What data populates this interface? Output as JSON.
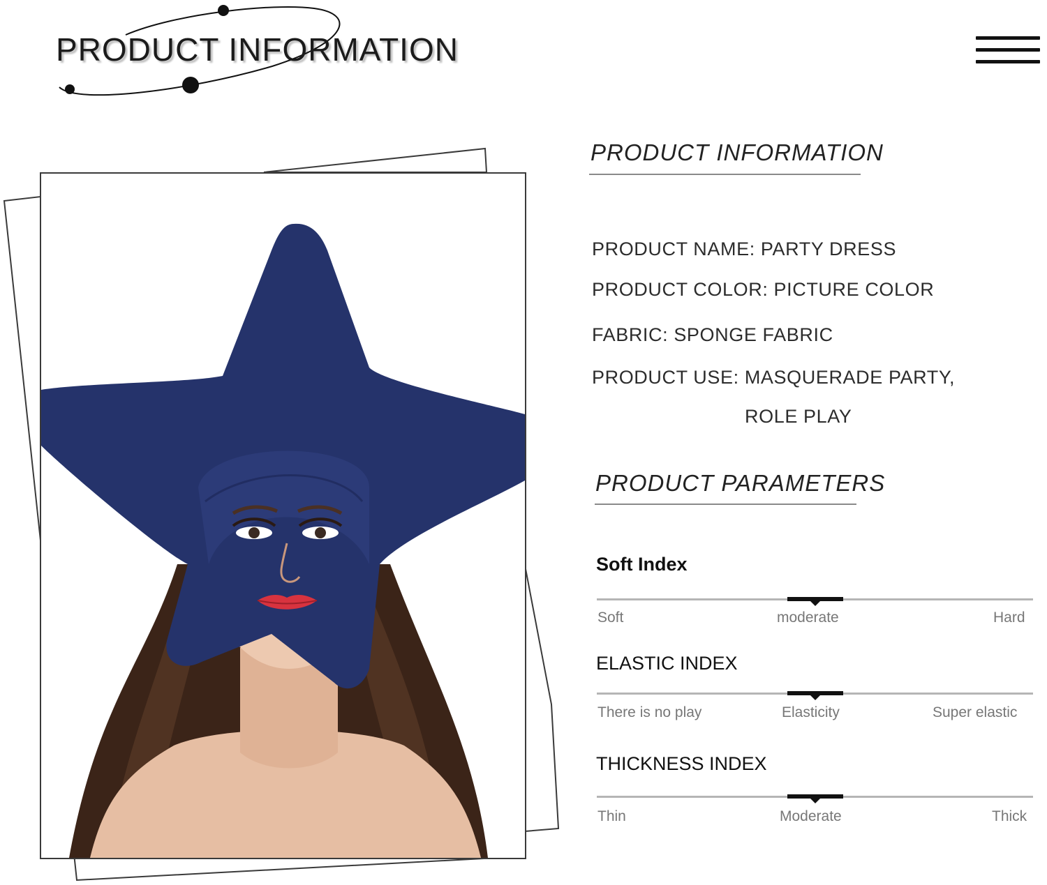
{
  "header": {
    "title": "PRODUCT INFORMATION"
  },
  "info_section": {
    "title": "PRODUCT INFORMATION",
    "lines": [
      "PRODUCT NAME: PARTY DRESS",
      "PRODUCT COLOR: PICTURE COLOR",
      "FABRIC: SPONGE FABRIC",
      "PRODUCT USE: MASQUERADE PARTY,",
      "ROLE PLAY"
    ]
  },
  "params_section": {
    "title": "PRODUCT PARAMETERS",
    "scales": [
      {
        "label": "Soft Index",
        "left": "Soft",
        "middle": "moderate",
        "right": "Hard",
        "level": 0.5
      },
      {
        "label": "ELASTIC INDEX",
        "left": "There is no play",
        "middle": "Elasticity",
        "right": "Super elastic",
        "level": 0.5
      },
      {
        "label": "THICKNESS INDEX",
        "left": "Thin",
        "middle": "Moderate",
        "right": "Thick",
        "level": 0.5
      }
    ]
  },
  "colors": {
    "hat": "#25336b",
    "lips": "#d8333f",
    "hair": "#3b2418",
    "skin": "#e8c2a8"
  },
  "icons": [
    "menu-icon",
    "orbit-decoration"
  ]
}
